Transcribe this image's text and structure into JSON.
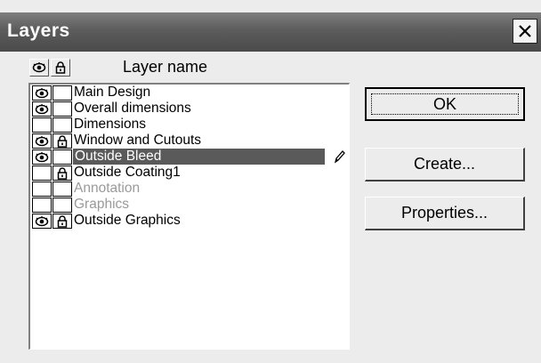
{
  "window": {
    "title": "Layers"
  },
  "header": {
    "column_label": "Layer name",
    "visibility_icon": "eye-icon",
    "lock_icon": "lock-icon"
  },
  "layers": [
    {
      "name": "Main Design",
      "visible": true,
      "locked": false,
      "dimmed": false,
      "selected": false
    },
    {
      "name": "Overall dimensions",
      "visible": true,
      "locked": false,
      "dimmed": false,
      "selected": false
    },
    {
      "name": "Dimensions",
      "visible": false,
      "locked": false,
      "dimmed": false,
      "selected": false
    },
    {
      "name": "Window and Cutouts",
      "visible": true,
      "locked": true,
      "dimmed": false,
      "selected": false
    },
    {
      "name": "Outside Bleed",
      "visible": true,
      "locked": false,
      "dimmed": false,
      "selected": true
    },
    {
      "name": "Outside Coating1",
      "visible": false,
      "locked": true,
      "dimmed": false,
      "selected": false
    },
    {
      "name": "Annotation",
      "visible": false,
      "locked": false,
      "dimmed": true,
      "selected": false
    },
    {
      "name": "Graphics",
      "visible": false,
      "locked": false,
      "dimmed": true,
      "selected": false
    },
    {
      "name": "Outside Graphics",
      "visible": true,
      "locked": true,
      "dimmed": false,
      "selected": false
    }
  ],
  "buttons": {
    "ok": "OK",
    "create": "Create...",
    "properties": "Properties..."
  },
  "colors": {
    "titlebar": "#5c5c5c",
    "selection": "#5a5a5a",
    "dimmed_text": "#9a9a9a"
  }
}
